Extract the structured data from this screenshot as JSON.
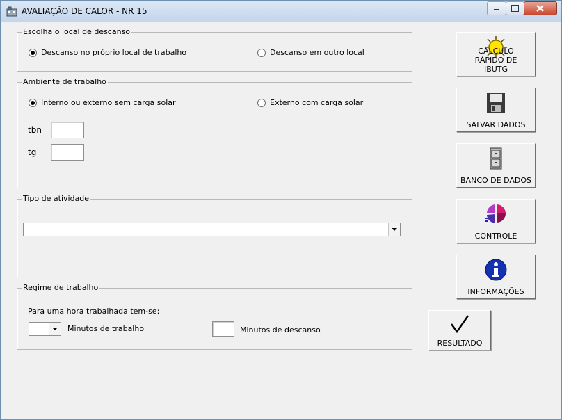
{
  "window": {
    "title": "AVALIAÇÃO DE CALOR - NR 15"
  },
  "descanso": {
    "legend": "Escolha o local de descanso",
    "option_own": "Descanso no próprio local de trabalho",
    "option_other": "Descanso em outro local"
  },
  "ambiente": {
    "legend": "Ambiente de trabalho",
    "option_internal": "Interno ou externo sem carga solar",
    "option_external": "Externo com carga solar",
    "tbn_label": "tbn",
    "tg_label": "tg"
  },
  "atividade": {
    "legend": "Tipo de atividade",
    "selected": ""
  },
  "regime": {
    "legend": "Regime de trabalho",
    "intro": "Para uma hora trabalhada tem-se:",
    "work_label": "Minutos de trabalho",
    "rest_label": "Minutos de descanso"
  },
  "buttons": {
    "calc": "CÁLCULO RÁPIDO DE IBUTG",
    "save": "SALVAR DADOS",
    "db": "BANCO DE DADOS",
    "control": "CONTROLE",
    "info": "INFORMAÇÕES",
    "result": "RESULTADO"
  }
}
